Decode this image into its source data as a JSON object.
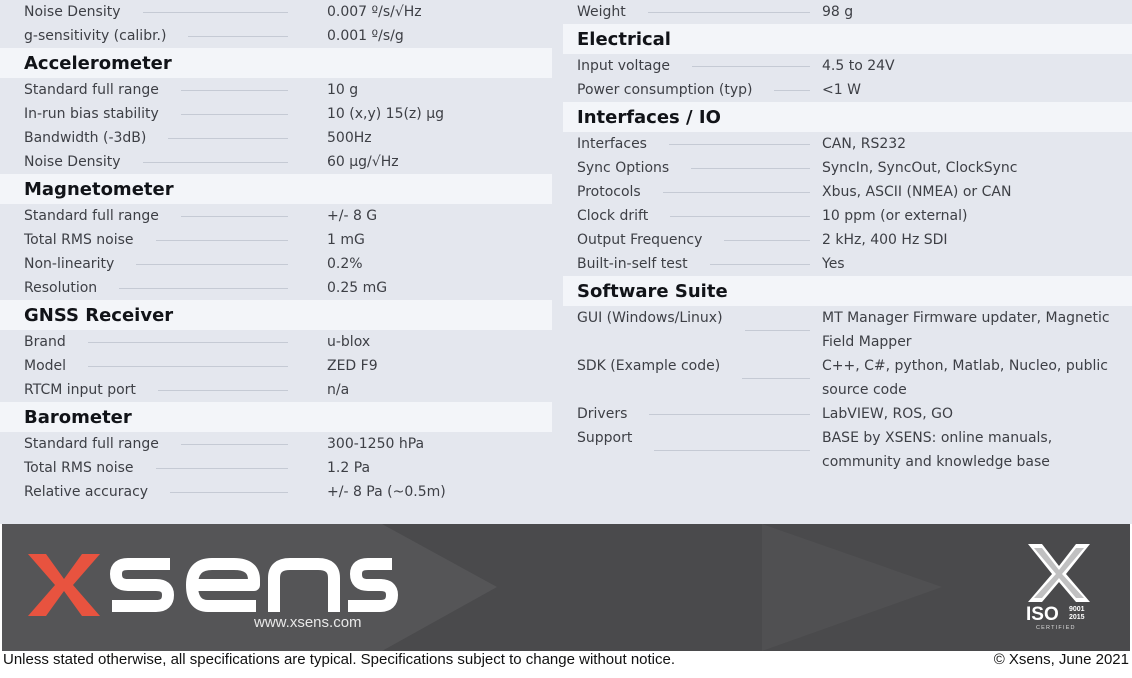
{
  "left_column": [
    {
      "type": "row",
      "label": "Noise Density",
      "value": "0.007 º/s/√Hz"
    },
    {
      "type": "row",
      "label": "g-sensitivity (calibr.)",
      "value": "0.001 º/s/g"
    },
    {
      "type": "section",
      "title": "Accelerometer"
    },
    {
      "type": "row",
      "label": "Standard full range",
      "value": "10 g"
    },
    {
      "type": "row",
      "label": "In-run bias stability",
      "value": "10 (x,y) 15(z) µg"
    },
    {
      "type": "row",
      "label": "Bandwidth (-3dB)",
      "value": "500Hz"
    },
    {
      "type": "row",
      "label": "Noise Density",
      "value": "60 µg/√Hz"
    },
    {
      "type": "section",
      "title": "Magnetometer"
    },
    {
      "type": "row",
      "label": "Standard full range",
      "value": "+/- 8 G"
    },
    {
      "type": "row",
      "label": "Total RMS noise",
      "value": "1 mG"
    },
    {
      "type": "row",
      "label": "Non-linearity",
      "value": "0.2%"
    },
    {
      "type": "row",
      "label": "Resolution",
      "value": "0.25 mG"
    },
    {
      "type": "section",
      "title": "GNSS Receiver"
    },
    {
      "type": "row",
      "label": "Brand",
      "value": "u-blox"
    },
    {
      "type": "row",
      "label": "Model",
      "value": "ZED F9"
    },
    {
      "type": "row",
      "label": "RTCM input port",
      "value": "n/a"
    },
    {
      "type": "section",
      "title": "Barometer"
    },
    {
      "type": "row",
      "label": "Standard full range",
      "value": "300-1250 hPa"
    },
    {
      "type": "row",
      "label": "Total RMS noise",
      "value": "1.2 Pa"
    },
    {
      "type": "row",
      "label": "Relative accuracy",
      "value": "+/- 8 Pa (~0.5m)"
    }
  ],
  "right_column": [
    {
      "type": "row",
      "label": "Weight",
      "value": "98 g"
    },
    {
      "type": "section",
      "title": "Electrical"
    },
    {
      "type": "row",
      "label": "Input voltage",
      "value": "4.5 to 24V"
    },
    {
      "type": "row",
      "label": "Power consumption (typ)",
      "value": "<1 W"
    },
    {
      "type": "section",
      "title": "Interfaces / IO"
    },
    {
      "type": "row",
      "label": "Interfaces",
      "value": "CAN, RS232"
    },
    {
      "type": "row",
      "label": "Sync Options",
      "value": "SyncIn, SyncOut, ClockSync"
    },
    {
      "type": "row",
      "label": "Protocols",
      "value": "Xbus, ASCII (NMEA) or CAN"
    },
    {
      "type": "row",
      "label": "Clock drift",
      "value": "10 ppm (or external)"
    },
    {
      "type": "row",
      "label": "Output Frequency",
      "value": "2 kHz, 400 Hz SDI"
    },
    {
      "type": "row",
      "label": "Built-in-self test",
      "value": "Yes"
    },
    {
      "type": "section",
      "title": "Software Suite"
    },
    {
      "type": "multi",
      "label": "GUI (Windows/Linux)",
      "value": "MT Manager Firmware updater, Magnetic Field Mapper"
    },
    {
      "type": "multi",
      "label": "SDK (Example code)",
      "value": "C++, C#, python, Matlab, Nucleo, public source code"
    },
    {
      "type": "row",
      "label": "Drivers",
      "value": "LabVIEW, ROS, GO"
    },
    {
      "type": "multi",
      "label": "Support",
      "value": "BASE by XSENS: online manuals, community and knowledge base"
    }
  ],
  "footer": {
    "brand_logo": "xsens",
    "website": "www.xsens.com",
    "iso_label": "ISO",
    "iso_standard": "9001",
    "iso_year": "2015",
    "iso_certified": "CERTIFIED",
    "logo_color": "#e8533f"
  },
  "disclaimer": "Unless stated otherwise, all specifications are typical. Specifications subject to change without notice.",
  "copyright": "© Xsens, June 2021"
}
